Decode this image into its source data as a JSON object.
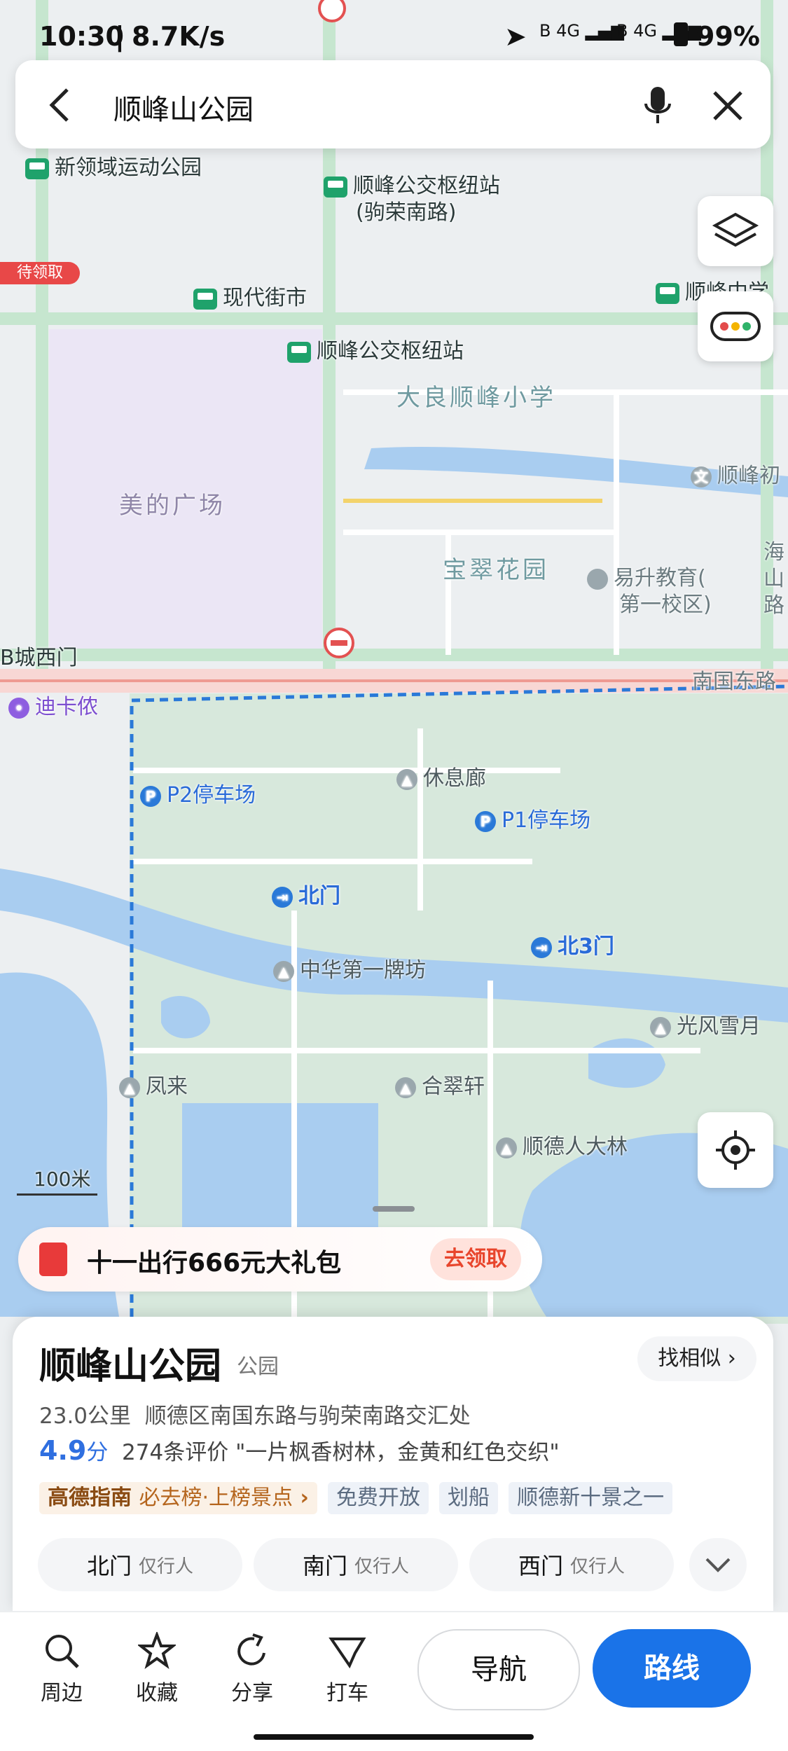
{
  "status_bar": {
    "time": "10:30",
    "speed": "8.7K/s",
    "battery": "99%",
    "network": "4G"
  },
  "search": {
    "query": "顺峰山公园"
  },
  "map": {
    "labels": {
      "xinlingyu": "新领域运动公园",
      "shunfeng_hub_jurong": "顺峰公交枢纽站",
      "shunfeng_hub_jurong_sub": "(驹荣南路)",
      "pending_badge": "待领取",
      "modern_street": "现代街市",
      "shunfeng_hub": "顺峰公交枢纽站",
      "shunfeng_middle": "顺峰中学",
      "daliang_primary": "大良顺峰小学",
      "midea_plaza": "美的广场",
      "baocui_garden": "宝翠花园",
      "yisheng_edu": "易升教育(",
      "yisheng_edu_2": "第一校区)",
      "shunfeng_chu": "顺峰初",
      "city_west_gate": "B城西门",
      "dikanong": "迪卡侬",
      "nanguo_road": "南国东路",
      "haishan_road": "海山路",
      "p2_parking": "P2停车场",
      "p1_parking": "P1停车场",
      "rest_corridor": "休息廊",
      "north_gate": "北门",
      "north_gate_3": "北3门",
      "zhonghua_arch": "中华第一牌坊",
      "guangfeng": "光风雪月",
      "fenglai": "凤来",
      "hecui": "合翠轩",
      "shunde_forest": "顺德人大林",
      "scale": "100米"
    }
  },
  "promo": {
    "text": "十一出行666元大礼包",
    "button": "去领取"
  },
  "place": {
    "name": "顺峰山公园",
    "category": "公园",
    "similar_button": "找相似",
    "distance": "23.0公里",
    "address": "顺德区南国东路与驹荣南路交汇处",
    "rating": "4.9",
    "rating_unit": "分",
    "reviews": "274条评价",
    "quote": "\"一片枫香树林，金黄和红色交织\"",
    "guide_brand": "高德指南",
    "guide_text": "必去榜·上榜景点",
    "tags": [
      "免费开放",
      "划船",
      "顺德新十景之一"
    ]
  },
  "gates": [
    {
      "name": "北门",
      "note": "仅行人"
    },
    {
      "name": "南门",
      "note": "仅行人"
    },
    {
      "name": "西门",
      "note": "仅行人"
    }
  ],
  "actions": {
    "nearby": "周边",
    "favorite": "收藏",
    "share": "分享",
    "taxi": "打车",
    "navigate": "导航",
    "route": "路线"
  },
  "colors": {
    "accent": "#1a73e8",
    "park_green": "#cfe8dc",
    "water": "#a9cdf0",
    "rating_blue": "#2f6fe0"
  }
}
